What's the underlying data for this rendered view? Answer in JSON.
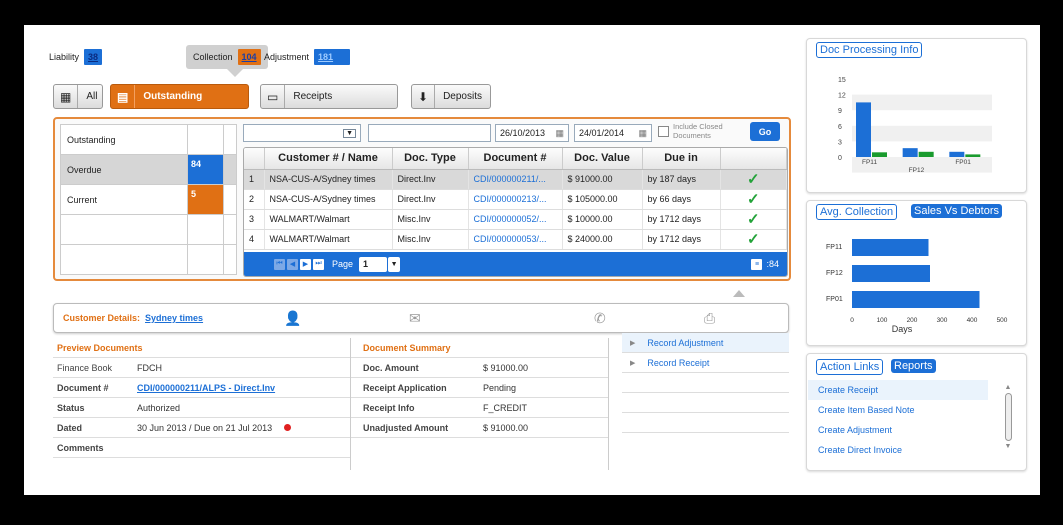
{
  "counters": {
    "liability": {
      "label": "Liability",
      "value": "38"
    },
    "collection": {
      "label": "Collection",
      "value": "104"
    },
    "adjustment": {
      "label": "Adjustment",
      "value": "181"
    }
  },
  "tabs": {
    "all": "All",
    "outstanding": "Outstanding",
    "receipts": "Receipts",
    "deposits": "Deposits"
  },
  "left_summary": [
    {
      "label": "Outstanding",
      "value": ""
    },
    {
      "label": "Overdue",
      "value": "84"
    },
    {
      "label": "Current",
      "value": "5"
    },
    {
      "label": "",
      "value": ""
    },
    {
      "label": "",
      "value": ""
    }
  ],
  "filters": {
    "date_from": "26/10/2013",
    "date_to": "24/01/2014",
    "include_closed_label": "Include Closed Documents",
    "go_label": "Go"
  },
  "grid": {
    "columns": [
      "",
      "Customer # / Name",
      "Doc. Type",
      "Document #",
      "Doc. Value",
      "Due in",
      ""
    ],
    "rows": [
      {
        "num": "1",
        "customer": "NSA-CUS-A/Sydney times",
        "type": "Direct.Inv",
        "doc": "CDI/000000211/...",
        "value": "$ 91000.00",
        "due": "by 187 days"
      },
      {
        "num": "2",
        "customer": "NSA-CUS-A/Sydney times",
        "type": "Direct.Inv",
        "doc": "CDI/000000213/...",
        "value": "$ 105000.00",
        "due": "by 66 days"
      },
      {
        "num": "3",
        "customer": "WALMART/Walmart",
        "type": "Misc.Inv",
        "doc": "CDI/000000052/...",
        "value": "$ 10000.00",
        "due": "by 1712 days"
      },
      {
        "num": "4",
        "customer": "WALMART/Walmart",
        "type": "Misc.Inv",
        "doc": "CDI/000000053/...",
        "value": "$ 24000.00",
        "due": "by 1712 days"
      }
    ],
    "pager": {
      "page_label": "Page",
      "page": "1",
      "count": ":84"
    }
  },
  "customer_details": {
    "label": "Customer Details:",
    "name": "Sydney times"
  },
  "preview": {
    "title": "Preview Documents",
    "fields": [
      {
        "k": "Finance Book",
        "v": "FDCH"
      },
      {
        "k": "Document #",
        "v": "CDI/000000211/ALPS - Direct.Inv"
      },
      {
        "k": "Status",
        "v": "Authorized"
      },
      {
        "k": "Dated",
        "v": "30 Jun 2013 / Due on 21 Jul 2013"
      },
      {
        "k": "Comments",
        "v": ""
      }
    ]
  },
  "doc_summary": {
    "title": "Document Summary",
    "fields": [
      {
        "k": "Doc. Amount",
        "v": "$ 91000.00"
      },
      {
        "k": "Receipt Application",
        "v": "Pending"
      },
      {
        "k": "Receipt Info",
        "v": "F_CREDIT"
      },
      {
        "k": "Unadjusted Amount",
        "v": "$ 91000.00"
      }
    ]
  },
  "actions": [
    "Record Adjustment",
    "Record Receipt"
  ],
  "doc_processing": {
    "title": "Doc Processing Info",
    "chart_data": {
      "type": "bar",
      "categories": [
        "FP11",
        "FP12",
        "FP01"
      ],
      "series": [
        {
          "values": [
            10.5,
            1.7,
            1.0
          ]
        },
        {
          "values": [
            0.9,
            1.0,
            0.5
          ]
        }
      ],
      "ylim": [
        0,
        15
      ],
      "yticks": [
        "15",
        "12",
        "9",
        "6",
        "3",
        "0"
      ],
      "colors": [
        "#1c6fd6",
        "#1a9b2e"
      ]
    }
  },
  "avg_collection": {
    "tab1": "Avg. Collection",
    "tab2": "Sales Vs Debtors",
    "chart_data": {
      "type": "bar",
      "categories": [
        "FP11",
        "FP12",
        "FP01"
      ],
      "values": [
        255,
        260,
        425
      ],
      "xlabel": "Days",
      "xlim": [
        0,
        500
      ],
      "xticks": [
        "0",
        "100",
        "200",
        "300",
        "400",
        "500"
      ]
    }
  },
  "action_links": {
    "tab1": "Action Links",
    "tab2": "Reports",
    "items": [
      "Create Receipt",
      "Create Item Based Note",
      "Create Adjustment",
      "Create Direct Invoice"
    ]
  }
}
